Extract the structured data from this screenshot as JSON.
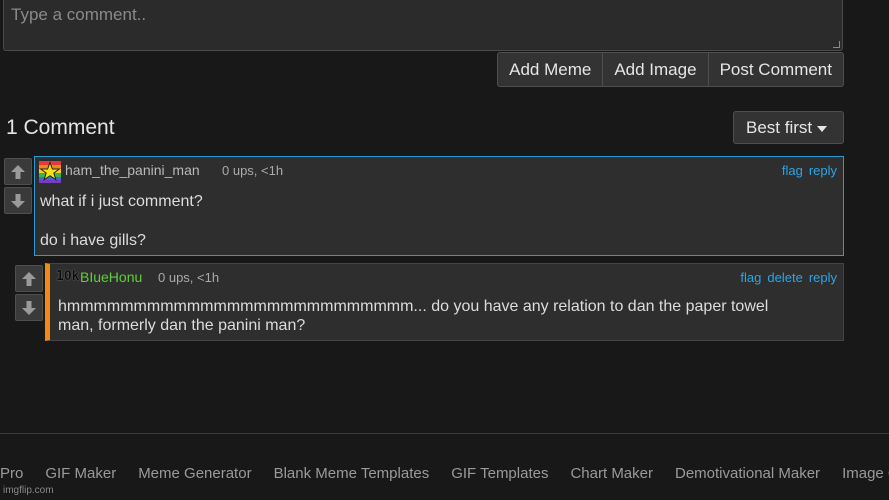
{
  "composer": {
    "placeholder": "Type a comment..",
    "buttons": [
      "Add Meme",
      "Add Image",
      "Post Comment"
    ]
  },
  "comments_header": {
    "count": "1 Comment",
    "sort": "Best first"
  },
  "comments": [
    {
      "author": "ham_the_panini_man",
      "meta": "0 ups, <1h",
      "actions": [
        "flag",
        "reply"
      ],
      "lines": [
        "what if i just comment?",
        "do i have gills?"
      ]
    },
    {
      "badge": "10k",
      "author": "BIueHonu",
      "meta": "0 ups, <1h",
      "actions": [
        "flag",
        "delete",
        "reply"
      ],
      "lines": [
        "hmmmmmmmmmmmmmmmmmmmmmmmmmm... do you have any relation to dan the paper towel",
        "man, formerly dan the panini man?"
      ]
    }
  ],
  "footer": {
    "links": [
      "Pro",
      "GIF Maker",
      "Meme Generator",
      "Blank Meme Templates",
      "GIF Templates",
      "Chart Maker",
      "Demotivational Maker",
      "Image C"
    ],
    "watermark": "imgflip.com"
  },
  "colors": {
    "accent_link": "#2aa5e6",
    "reply_bar": "#f08a14",
    "highlight_border": "#2a9ad6",
    "username_green": "#5fcf3a"
  }
}
